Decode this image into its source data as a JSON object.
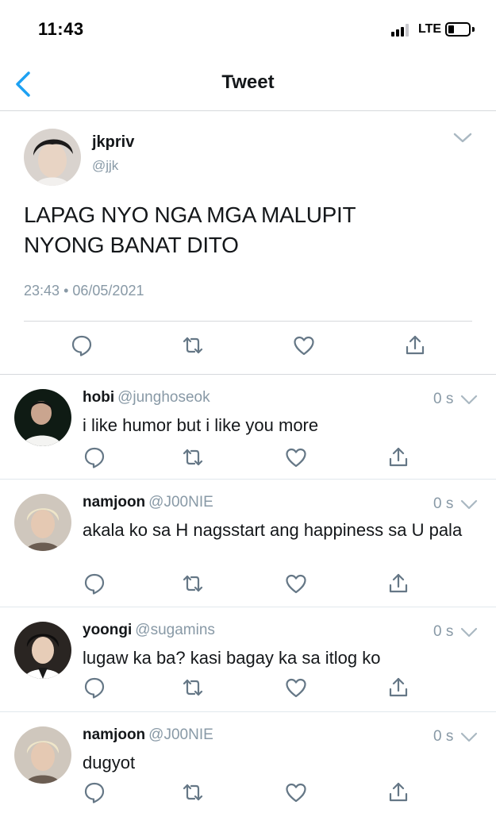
{
  "status_bar": {
    "time": "11:43",
    "network": "LTE",
    "battery_level": 0.25
  },
  "nav": {
    "title": "Tweet"
  },
  "main_tweet": {
    "name": "jkpriv",
    "handle": "@jjk",
    "text_line1": "LAPAG NYO NGA MGA MALUPIT",
    "text_line2": "NYONG BANAT DITO",
    "time": "23:43",
    "separator": "•",
    "date": "06/05/2021"
  },
  "replies": [
    {
      "name": "hobi",
      "handle": "@junghoseok",
      "time": "0 s",
      "text": "i like humor but i like you more"
    },
    {
      "name": "namjoon",
      "handle": "@J00NIE",
      "time": "0 s",
      "text": "akala ko sa H nagsstart ang happiness sa U pala"
    },
    {
      "name": "yoongi",
      "handle": "@sugamins",
      "time": "0 s",
      "text": "lugaw ka ba? kasi bagay ka sa itlog ko"
    },
    {
      "name": "namjoon",
      "handle": "@J00NIE",
      "time": "0 s",
      "text": "dugyot"
    }
  ],
  "icons": {
    "back": "chevron-left-icon",
    "menu": "chevron-down-icon",
    "reply": "comment-icon",
    "retweet": "retweet-icon",
    "like": "heart-icon",
    "share": "share-icon"
  },
  "colors": {
    "accent": "#1da1f2",
    "icon_gray": "#657786",
    "secondary_text": "#8899a6",
    "divider": "#d6d9dc"
  }
}
